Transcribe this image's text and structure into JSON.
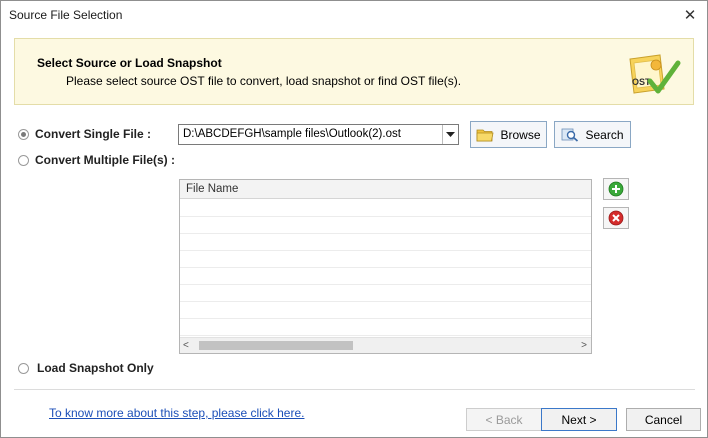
{
  "window": {
    "title": "Source File Selection",
    "close_label": "✕"
  },
  "banner": {
    "title": "Select Source or Load Snapshot",
    "description": "Please select source OST file to convert, load snapshot or find OST file(s).",
    "logo_text": "OST"
  },
  "options": {
    "single_label": "Convert Single File :",
    "multiple_label": "Convert Multiple File(s) :",
    "snapshot_label": "Load Snapshot Only",
    "selected": "single"
  },
  "file_path": {
    "value": "D:\\ABCDEFGH\\sample files\\Outlook(2).ost"
  },
  "toolbar": {
    "browse_label": "Browse",
    "search_label": "Search"
  },
  "file_list": {
    "column_header": "File Name",
    "rows": []
  },
  "footer": {
    "help_link": "To know more about this step, please click here.",
    "back_label": "< Back",
    "next_label": "Next >",
    "cancel_label": "Cancel"
  },
  "colors": {
    "banner_bg": "#fdf9e1",
    "link": "#1c4fb8",
    "add_icon": "#3aa93a",
    "remove_icon": "#d42b2b"
  }
}
